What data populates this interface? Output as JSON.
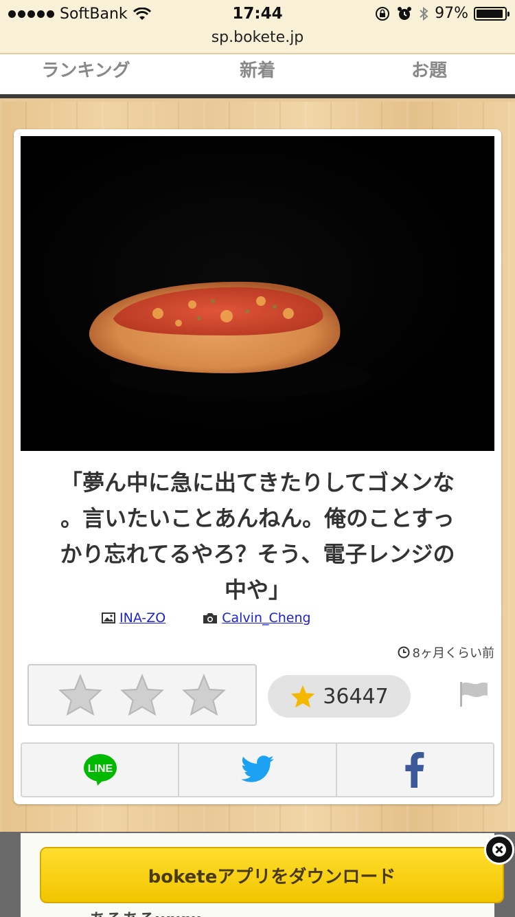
{
  "status": {
    "carrier": "SoftBank",
    "time": "17:44",
    "battery": "97%"
  },
  "url": "sp.bokete.jp",
  "tabs": [
    {
      "label": "ランキング"
    },
    {
      "label": "新着"
    },
    {
      "label": "お題"
    }
  ],
  "post": {
    "caption": "「夢ん中に急に出てきたりしてゴメンな。言いたいことあんねん。俺のことすっかり忘れてるやろ？そう、電子レンジの中や」",
    "caption_lines": [
      "「夢ん中に急に出てきたりしてゴメンな",
      "。言いたいことあんねん。俺のことすっ",
      "かり忘れてるやろ？そう、電子レンジの",
      "中や」"
    ],
    "boke_author": "INA-ZO",
    "photo_author": "Calvin_Cheng",
    "time_ago": "8ヶ月くらい前",
    "score": "36447"
  },
  "banner": {
    "label": "boketeアプリをダウンロード"
  },
  "peek": {
    "text": "あるあるwww"
  },
  "colors": {
    "banner": "#f2c500",
    "line_green": "#00b900",
    "twitter_blue": "#1da1f2",
    "facebook_blue": "#3b5998",
    "star_gold": "#f5b800"
  }
}
